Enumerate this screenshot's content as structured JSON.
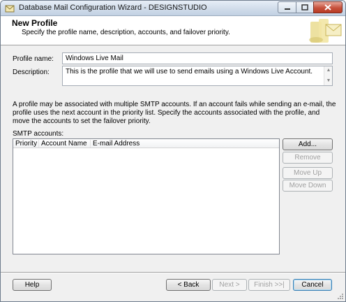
{
  "window": {
    "title": "Database Mail Configuration Wizard - DESIGNSTUDIO",
    "app_icon": "database-mail-icon"
  },
  "header": {
    "title": "New Profile",
    "subtitle": "Specify the profile name, description, accounts, and failover priority.",
    "graphic": "wizard-banner-graphic"
  },
  "form": {
    "profile_name_label": "Profile name:",
    "profile_name_value": "Windows Live Mail",
    "description_label": "Description:",
    "description_value": "This is the profile that we will use to send emails using a Windows Live Account."
  },
  "info": {
    "text": "A profile may be associated with multiple SMTP accounts. If an account fails while sending an e-mail, the profile uses the next account in the priority list. Specify the accounts associated with the profile, and move the accounts to set the failover priority."
  },
  "smtp": {
    "label": "SMTP accounts:",
    "columns": [
      "Priority",
      "Account Name",
      "E-mail Address"
    ],
    "rows": []
  },
  "side_buttons": {
    "add": "Add...",
    "remove": "Remove",
    "move_up": "Move Up",
    "move_down": "Move Down"
  },
  "footer_buttons": {
    "help": "Help",
    "back": "< Back",
    "next": "Next >",
    "finish": "Finish >>|",
    "cancel": "Cancel"
  }
}
